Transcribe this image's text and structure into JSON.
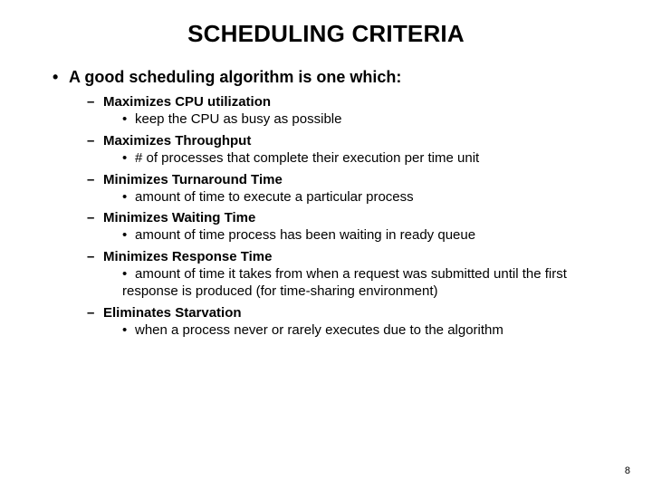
{
  "title": "SCHEDULING CRITERIA",
  "lead": "A good scheduling algorithm is one which:",
  "items": [
    {
      "h": "Maximizes CPU utilization",
      "d": "keep the CPU as busy as possible"
    },
    {
      "h": "Maximizes Throughput",
      "d": "# of processes that complete their execution per time unit"
    },
    {
      "h": "Minimizes Turnaround Time",
      "d": "amount of time to execute a particular process"
    },
    {
      "h": "Minimizes Waiting Time",
      "d": "amount of time process has been waiting in ready queue"
    },
    {
      "h": "Minimizes Response Time",
      "d": "amount of time it takes from when a request was submitted until the first response is produced (for time-sharing environment)"
    },
    {
      "h": "Eliminates Starvation",
      "d": "when a process never or rarely executes due to the algorithm"
    }
  ],
  "page": "8"
}
